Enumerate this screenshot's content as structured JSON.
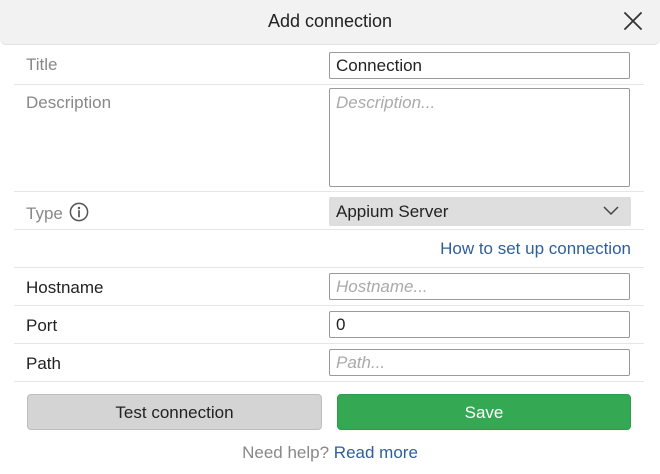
{
  "dialog": {
    "title": "Add connection"
  },
  "form": {
    "title_label": "Title",
    "title_value": "Connection",
    "description_label": "Description",
    "description_placeholder": "Description...",
    "type_label": "Type",
    "type_value": "Appium Server",
    "setup_link": "How to set up connection",
    "hostname_label": "Hostname",
    "hostname_placeholder": "Hostname...",
    "port_label": "Port",
    "port_value": "0",
    "path_label": "Path",
    "path_placeholder": "Path..."
  },
  "actions": {
    "test_label": "Test connection",
    "save_label": "Save"
  },
  "help": {
    "text": "Need help?",
    "link": "Read more"
  },
  "icons": {
    "close": "close-icon",
    "info": "info-icon",
    "dropdown": "chevron-down-icon"
  },
  "colors": {
    "save": "#34a853",
    "link": "#2f5f9a",
    "select_bg": "#dedede"
  }
}
